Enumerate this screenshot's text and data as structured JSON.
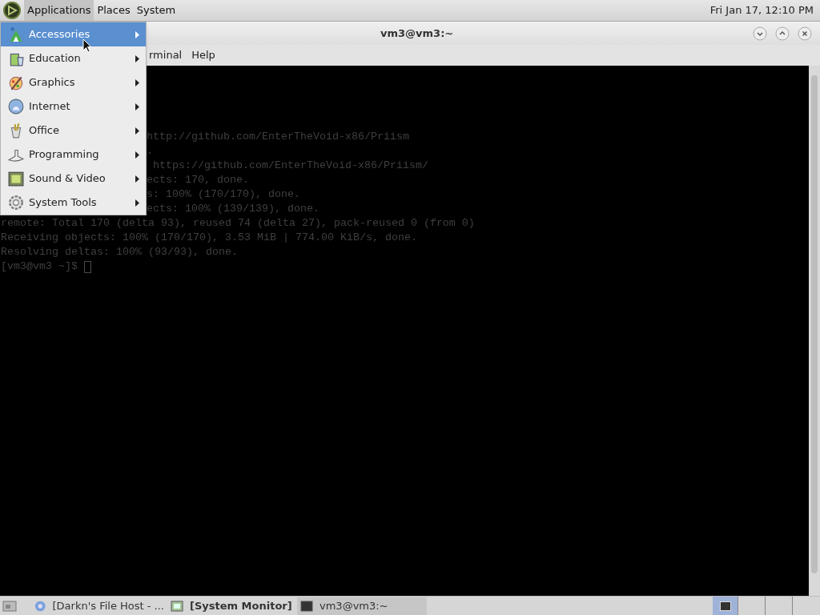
{
  "top_panel": {
    "menus": [
      {
        "label": "Applications",
        "selected": true
      },
      {
        "label": "Places",
        "selected": false
      },
      {
        "label": "System",
        "selected": false
      }
    ],
    "clock": "Fri Jan 17, 12:10 PM"
  },
  "window": {
    "title": "vm3@vm3:~",
    "menus": [
      "rminal",
      "Help"
    ]
  },
  "terminal": {
    "lines": [
      {
        "kind": "partial",
        "text": "http://github.com/EnterTheVoid-x86/Priism"
      },
      {
        "kind": "partial",
        "text": "."
      },
      {
        "kind": "partial",
        "text": " https://github.com/EnterTheVoid-x86/Priism/"
      },
      {
        "kind": "partial",
        "text": "ects: 170, done."
      },
      {
        "kind": "partial",
        "text": "s: 100% (170/170), done."
      },
      {
        "kind": "partial",
        "text": "ects: 100% (139/139), done."
      },
      {
        "kind": "full",
        "text": "remote: Total 170 (delta 93), reused 74 (delta 27), pack-reused 0 (from 0)"
      },
      {
        "kind": "full",
        "text": "Receiving objects: 100% (170/170), 3.53 MiB | 774.00 KiB/s, done."
      },
      {
        "kind": "full",
        "text": "Resolving deltas: 100% (93/93), done."
      },
      {
        "kind": "prompt",
        "text": "[vm3@vm3 ~]$ "
      }
    ]
  },
  "app_menu": {
    "items": [
      {
        "label": "Accessories",
        "selected": true
      },
      {
        "label": "Education",
        "selected": false
      },
      {
        "label": "Graphics",
        "selected": false
      },
      {
        "label": "Internet",
        "selected": false
      },
      {
        "label": "Office",
        "selected": false
      },
      {
        "label": "Programming",
        "selected": false
      },
      {
        "label": "Sound & Video",
        "selected": false
      },
      {
        "label": "System Tools",
        "selected": false
      }
    ]
  },
  "taskbar": {
    "tasks": [
      {
        "label": "[Darkn's File Host - ...",
        "selected": false
      },
      {
        "label": "[System Monitor]",
        "selected": false
      },
      {
        "label": "vm3@vm3:~",
        "selected": true
      }
    ]
  }
}
